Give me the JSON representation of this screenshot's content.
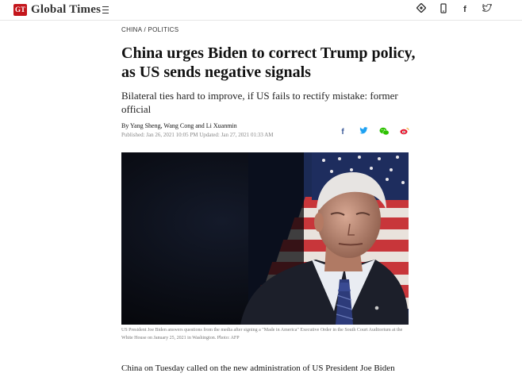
{
  "header": {
    "logo_badge": "GT",
    "logo_text": "Global Times",
    "icons": [
      "app-icon",
      "mobile-icon",
      "facebook-icon",
      "twitter-icon"
    ]
  },
  "article": {
    "category": "CHINA / POLITICS",
    "headline": "China urges Biden to correct Trump policy, as US sends negative signals",
    "subheadline": "Bilateral ties hard to improve, if US fails to rectify mistake: former official",
    "byline": "By Yang Sheng, Wang Cong and Li Xuanmin",
    "published": "Published: Jan 26, 2021 10:05 PM Updated: Jan 27, 2021 01:33 AM",
    "share_icons": [
      "facebook-icon",
      "twitter-icon",
      "wechat-icon",
      "weibo-icon"
    ],
    "photo_caption": "US President Joe Biden answers questions from the media after signing a \"Made in America\" Executive Order in the South Court Auditorium at the White House on January 25, 2021 in Washington. Photo: AFP",
    "body_first_line": "China on Tuesday called on the new administration of US President Joe Biden"
  },
  "colors": {
    "brand_red": "#c4161c",
    "facebook_blue": "#3b5998",
    "twitter_blue": "#1da1f2",
    "wechat_green": "#2dc100",
    "weibo_red": "#e6162d"
  }
}
